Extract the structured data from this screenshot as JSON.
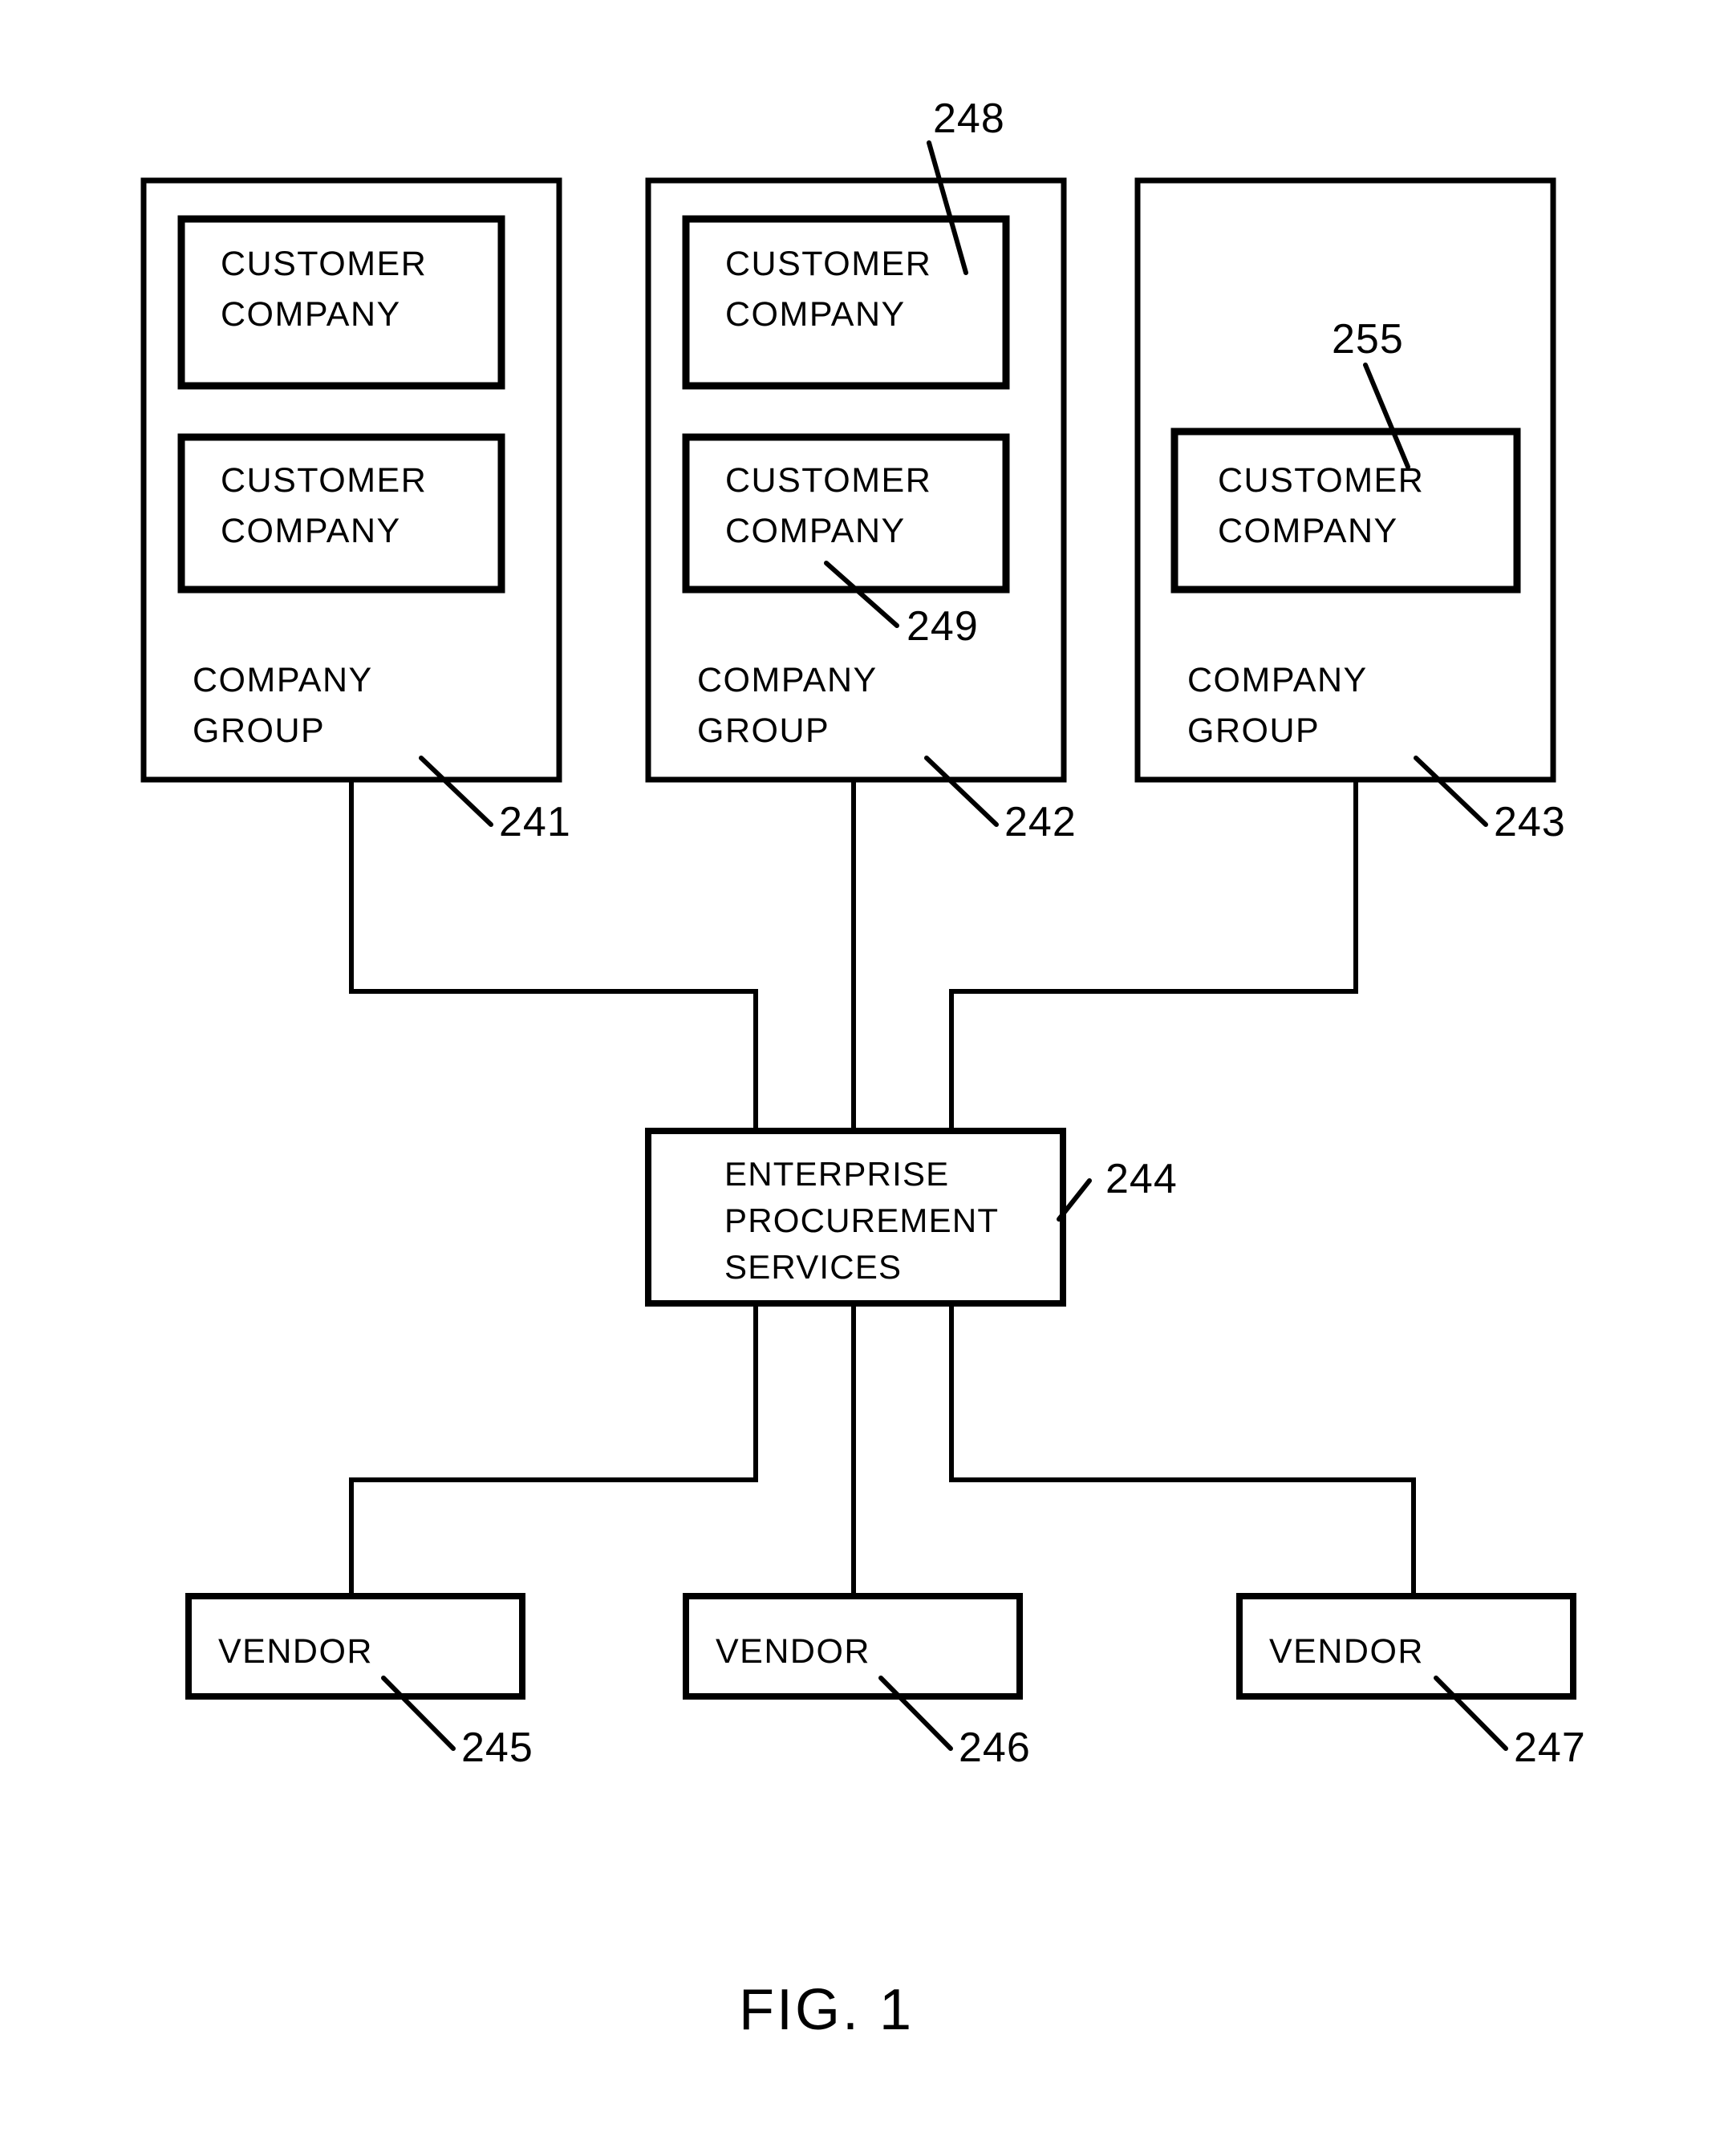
{
  "figure": {
    "caption": "FIG. 1",
    "title": "Enterprise procurement services network diagram"
  },
  "company_groups": [
    {
      "id": "group-1",
      "group_label_line1": "COMPANY",
      "group_label_line2": "GROUP",
      "ref": "241",
      "customers": [
        {
          "line1": "CUSTOMER",
          "line2": "COMPANY",
          "ref": ""
        },
        {
          "line1": "CUSTOMER",
          "line2": "COMPANY",
          "ref": ""
        }
      ]
    },
    {
      "id": "group-2",
      "group_label_line1": "COMPANY",
      "group_label_line2": "GROUP",
      "ref": "242",
      "customers": [
        {
          "line1": "CUSTOMER",
          "line2": "COMPANY",
          "ref": "248"
        },
        {
          "line1": "CUSTOMER",
          "line2": "COMPANY",
          "ref": "249"
        }
      ]
    },
    {
      "id": "group-3",
      "group_label_line1": "COMPANY",
      "group_label_line2": "GROUP",
      "ref": "243",
      "customers": [
        {
          "line1": "CUSTOMER",
          "line2": "COMPANY",
          "ref": "255"
        }
      ]
    }
  ],
  "enterprise_procurement_services": {
    "line1": "ENTERPRISE",
    "line2": "PROCUREMENT",
    "line3": "SERVICES",
    "ref": "244"
  },
  "vendors": [
    {
      "label": "VENDOR",
      "ref": "245"
    },
    {
      "label": "VENDOR",
      "ref": "246"
    },
    {
      "label": "VENDOR",
      "ref": "247"
    }
  ],
  "colors": {
    "ink": "#000000",
    "paper": "#ffffff"
  }
}
